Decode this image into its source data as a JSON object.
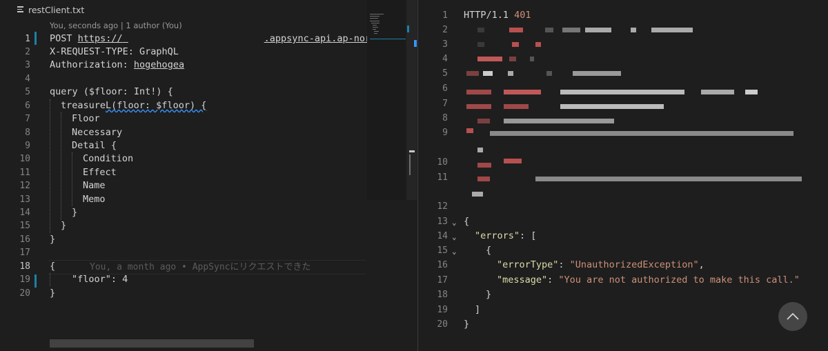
{
  "tab": {
    "label": "restClient.txt",
    "icon": "file-text-icon"
  },
  "codelens": {
    "text": "You, seconds ago | 1 author (You)"
  },
  "editor": {
    "line_numbers": [
      "1",
      "2",
      "3",
      "4",
      "5",
      "6",
      "7",
      "8",
      "9",
      "10",
      "11",
      "12",
      "13",
      "14",
      "15",
      "16",
      "17",
      "18",
      "19",
      "20"
    ],
    "lines": {
      "l1_method": "POST ",
      "l1_url_start": "https://",
      "l1_url_end": ".appsync-api.ap-nor",
      "l2": "X-REQUEST-TYPE: GraphQL",
      "l3_key": "Authorization: ",
      "l3_val": "hogehogea",
      "l5": "query ($floor: Int!) {",
      "l6_a": "treasure",
      "l6_b": "L(floor: $floor) {",
      "l7": "Floor",
      "l8": "Necessary",
      "l9": "Detail {",
      "l10": "Condition",
      "l11": "Effect",
      "l12": "Name",
      "l13": "Memo",
      "l14": "}",
      "l15": "}",
      "l16": "}",
      "l18": "{",
      "l19_key": "\"floor\"",
      "l19_rest": ": 4",
      "l20": "}"
    },
    "blame": "You, a month ago • AppSyncにリクエストできた"
  },
  "response": {
    "line_numbers": [
      "1",
      "2",
      "3",
      "4",
      "5",
      "6",
      "7",
      "8",
      "9",
      "10",
      "11",
      "12",
      "13",
      "14",
      "15",
      "16",
      "17",
      "18",
      "19",
      "20"
    ],
    "status_proto": "HTTP/1.1 ",
    "status_code": "401",
    "json": {
      "open_brace": "{",
      "errors_key": "\"errors\"",
      "colon_bracket": ": [",
      "inner_open": "{",
      "errorType_key": "\"errorType\"",
      "errorType_val": "\"UnauthorizedException\"",
      "message_key": "\"message\"",
      "message_val": "\"You are not authorized to make this call.\"",
      "inner_close": "}",
      "bracket_close": "]",
      "close_brace": "}"
    }
  },
  "scroll_top_button": {
    "icon": "chevron-up-icon"
  },
  "colors": {
    "background": "#1e1e1e",
    "git_modified": "#1b81a8",
    "json_key": "#dcdcaa",
    "json_string": "#ce9178",
    "status_code": "#ce9178"
  }
}
